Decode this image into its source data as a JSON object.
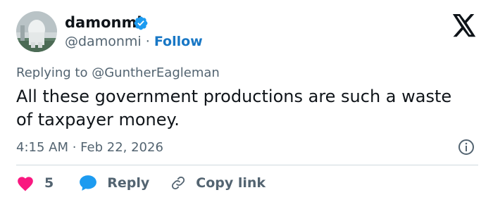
{
  "author": {
    "display_name": "damonmi",
    "handle": "@damonmi",
    "separator": "·",
    "follow_label": "Follow",
    "avatar_icon": "avatar-photo",
    "verified_icon": "verified-badge-icon"
  },
  "reply_context": {
    "prefix": "Replying to",
    "handle": "@GuntherEagleman"
  },
  "tweet": {
    "text": "All these government productions are such a waste of taxpayer money.",
    "timestamp": "4:15 AM · Feb 22, 2026"
  },
  "actions": {
    "like_count": "5",
    "reply_label": "Reply",
    "copy_link_label": "Copy link"
  },
  "colors": {
    "accent_blue": "#1d9bf0",
    "follow_blue": "#1877c5",
    "like_pink": "#f91880",
    "text_primary": "#0f1419",
    "text_secondary": "#536471",
    "divider": "#cfd9de"
  }
}
